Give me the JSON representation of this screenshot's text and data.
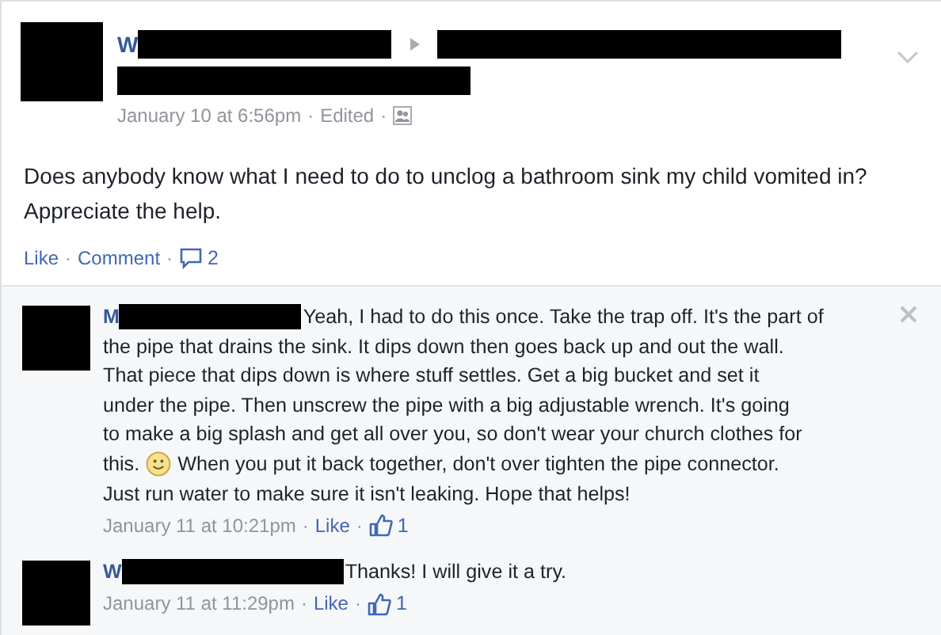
{
  "post": {
    "author_initial": "W",
    "date": "January 10 at 6:56pm",
    "separator": "·",
    "edited": "Edited",
    "text": "Does anybody know what I need to do to unclog a bathroom sink my child vomited in? Appreciate the help.",
    "like": "Like",
    "comment": "Comment",
    "comment_count": "2"
  },
  "comments": [
    {
      "author_initial": "M",
      "lines": [
        [
          {
            "kind": "text",
            "text": "Yeah, I had to do this once. Take the trap off. It's the part of"
          }
        ],
        [
          {
            "kind": "text",
            "text": "the pipe that drains the sink. It dips down then goes back up and out the wall."
          }
        ],
        [
          {
            "kind": "text",
            "text": "That piece that dips down is where stuff settles. Get a big bucket and set it"
          }
        ],
        [
          {
            "kind": "text",
            "text": "under the pipe. Then unscrew the pipe with a big adjustable wrench. It's going"
          }
        ],
        [
          {
            "kind": "text",
            "text": "to make a big splash and get all over you, so don't wear your church clothes for"
          }
        ],
        [
          {
            "kind": "text",
            "text": "this."
          },
          {
            "kind": "emoticon"
          },
          {
            "kind": "text",
            "text": "When you put it back together, don't over tighten the pipe connector."
          }
        ],
        [
          {
            "kind": "text",
            "text": "Just run water to make sure it isn't leaking. Hope that helps!"
          }
        ]
      ],
      "date": "January 11 at 10:21pm",
      "separator": "·",
      "like": "Like",
      "like_count": "1",
      "removable": true
    },
    {
      "author_initial": "W",
      "lines": [
        [
          {
            "kind": "text",
            "text": "Thanks! I will give it a try."
          }
        ]
      ],
      "date": "January 11 at 11:29pm",
      "separator": "·",
      "like": "Like",
      "like_count": "1",
      "removable": false
    }
  ]
}
